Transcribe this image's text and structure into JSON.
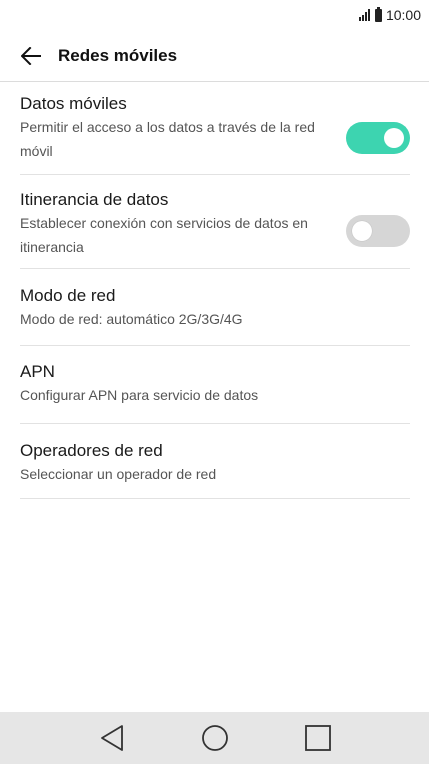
{
  "status_bar": {
    "time": "10:00"
  },
  "app_bar": {
    "title": "Redes móviles"
  },
  "settings": {
    "items": [
      {
        "title": "Datos móviles",
        "subtitle": "Permitir el acceso a los datos a través de la red móvil",
        "toggle": true
      },
      {
        "title": "Itinerancia de datos",
        "subtitle": "Establecer conexión con servicios de datos en itinerancia",
        "toggle": false
      },
      {
        "title": "Modo de red",
        "subtitle": "Modo de red: automático 2G/3G/4G"
      },
      {
        "title": "APN",
        "subtitle": "Configurar APN para servicio de datos"
      },
      {
        "title": "Operadores de red",
        "subtitle": "Seleccionar un operador de red"
      }
    ]
  },
  "colors": {
    "toggle_on": "#3dd4b0",
    "toggle_off": "#d6d6d6",
    "nav_bar": "#e6e6e6"
  },
  "icons": {
    "back": "arrow-left-icon",
    "nav_back": "triangle-back-icon",
    "nav_home": "circle-home-icon",
    "nav_recents": "square-recents-icon"
  }
}
